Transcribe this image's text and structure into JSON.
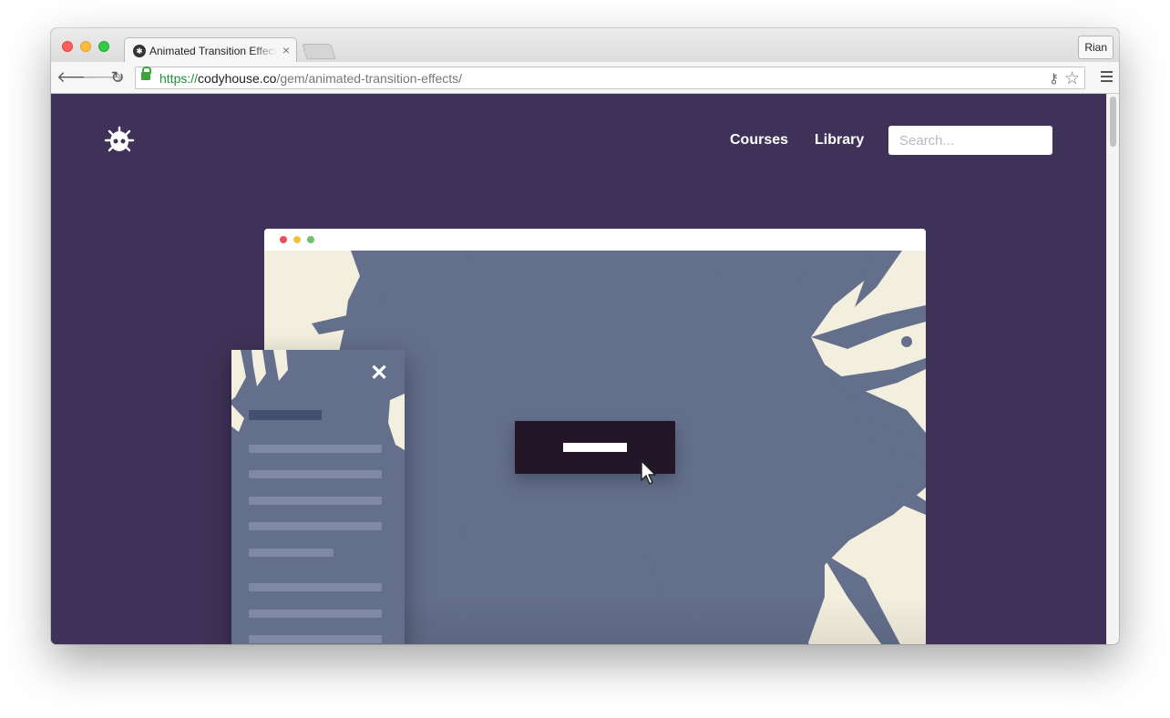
{
  "browser": {
    "tab_title": "Animated Transition Effects",
    "tab_close": "×",
    "profile_name": "Rian",
    "address": {
      "scheme": "https://",
      "host": "codyhouse.co",
      "path": "/gem/animated-transition-effects/"
    },
    "icons": {
      "back": "arrow-left-icon",
      "forward": "arrow-right-icon",
      "reload": "reload-icon",
      "lock": "lock-icon",
      "key": "key-icon",
      "star": "star-icon",
      "menu": "hamburger-menu-icon"
    }
  },
  "site": {
    "logo": "bug-logo-icon",
    "nav": {
      "courses": "Courses",
      "library": "Library"
    },
    "search": {
      "placeholder": "Search...",
      "value": ""
    }
  },
  "demo": {
    "close_symbol": "✕",
    "menu_items": 7
  },
  "colors": {
    "page_background": "#3f3258",
    "cta_background": "#231629",
    "splash": "#646f8c",
    "paper": "#f2efdf"
  }
}
